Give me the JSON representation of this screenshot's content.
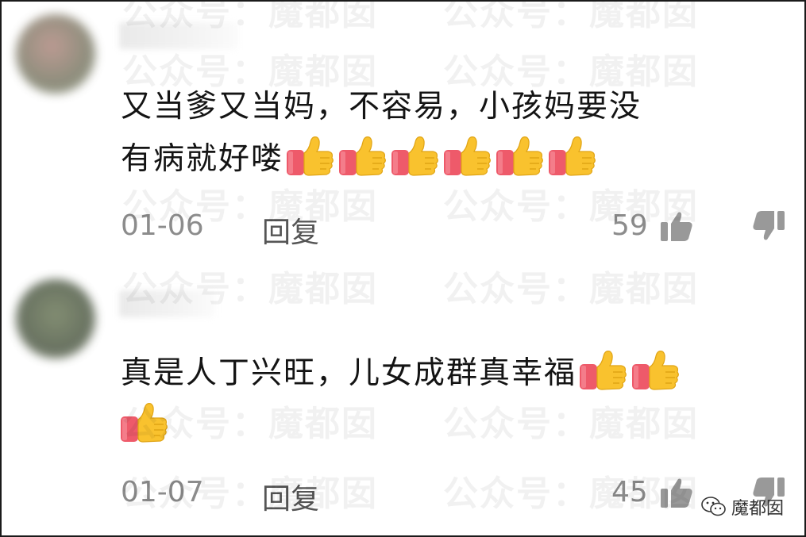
{
  "watermark": "公众号：魔都囡",
  "comments": [
    {
      "text_line1": "又当爹又当妈，不容易，小孩妈要没",
      "text_line2": "有病就好喽",
      "date": "01-06",
      "reply_label": "回复",
      "likes": "59"
    },
    {
      "text_line1": "真是人丁兴旺，儿女成群真幸福",
      "date": "01-07",
      "reply_label": "回复",
      "likes": "45"
    }
  ],
  "brand": {
    "name": "魔都囡"
  },
  "icons": [
    "thumbs-up-emoji",
    "like-icon",
    "dislike-icon",
    "wechat-icon"
  ]
}
